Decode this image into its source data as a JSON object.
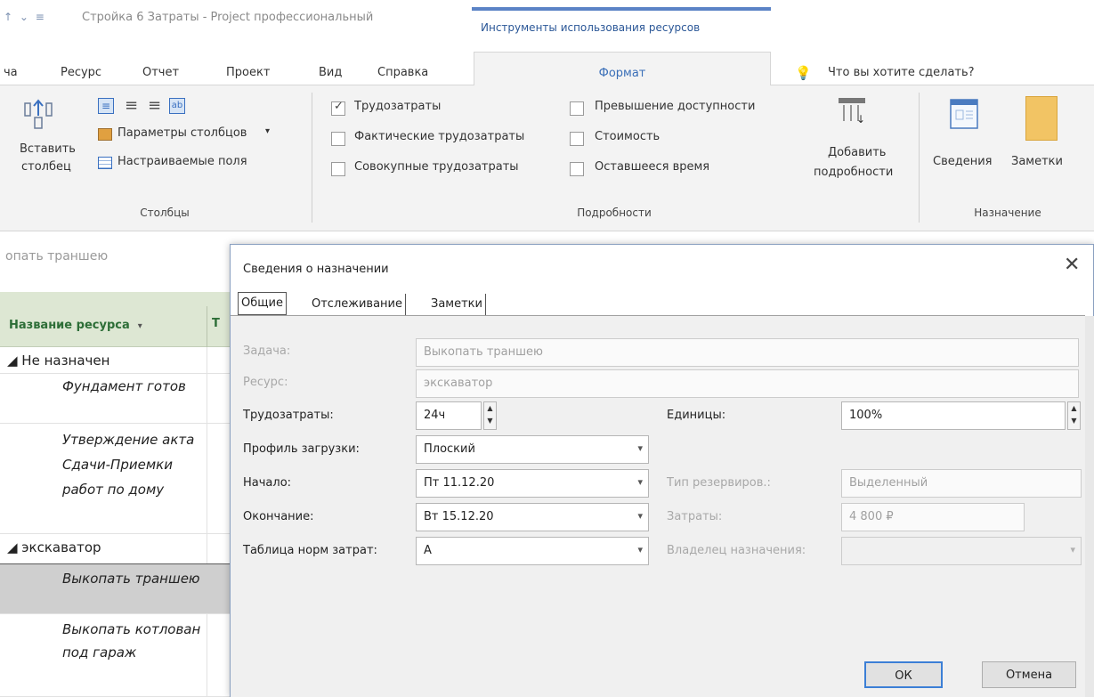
{
  "titlebar": {
    "qat": "↑ ⌄ ≡",
    "doc_title": "Стройка 6 Затраты - Project профессиональный",
    "context_tab": "Инструменты использования ресурсов"
  },
  "ribbon_tabs": {
    "task_partial": "ча",
    "resource": "Ресурс",
    "report": "Отчет",
    "project": "Проект",
    "view": "Вид",
    "help": "Справка",
    "format": "Формат",
    "tell_me": "Что вы хотите сделать?"
  },
  "ribbon": {
    "insert_column_line1": "Вставить",
    "insert_column_line2": "столбец",
    "column_settings": "Параметры столбцов",
    "custom_fields": "Настраиваемые поля",
    "columns_group": "Столбцы",
    "details": {
      "work": "Трудозатраты",
      "actual_work": "Фактические трудозатраты",
      "cumulative_work": "Совокупные трудозатраты",
      "overallocation": "Превышение доступности",
      "cost": "Стоимость",
      "remaining": "Оставшееся время",
      "add_details_line1": "Добавить",
      "add_details_line2": "подробности",
      "group": "Подробности"
    },
    "assignment": {
      "info": "Сведения",
      "notes": "Заметки",
      "group": "Назначение"
    }
  },
  "sheet": {
    "task_strip": "опать траншею",
    "col_name": "Название ресурса",
    "col_next": "Т",
    "rows": [
      {
        "label": "◢ Не назначен"
      },
      {
        "label": "Фундамент готов"
      },
      {
        "label": "Утверждение акта Сдачи-Приемки работ по дому"
      },
      {
        "label": "◢ экскаватор"
      },
      {
        "label": "Выкопать траншею"
      },
      {
        "label": "Выкопать котлован под гараж"
      }
    ]
  },
  "dialog": {
    "title": "Сведения о назначении",
    "tabs": [
      "Общие",
      "Отслеживание",
      "Заметки"
    ],
    "fields": {
      "task_label": "Задача:",
      "task_value": "Выкопать траншею",
      "resource_label": "Ресурс:",
      "resource_value": "экскаватор",
      "work_label": "Трудозатраты:",
      "work_value": "24ч",
      "units_label": "Единицы:",
      "units_value": "100%",
      "contour_label": "Профиль загрузки:",
      "contour_value": "Плоский",
      "start_label": "Начало:",
      "start_value": "Пт 11.12.20",
      "booking_label": "Тип резервиров.:",
      "booking_value": "Выделенный",
      "finish_label": "Окончание:",
      "finish_value": "Вт 15.12.20",
      "cost_label": "Затраты:",
      "cost_value": "4 800 ₽",
      "rate_label": "Таблица норм затрат:",
      "rate_value": "A",
      "owner_label": "Владелец назначения:",
      "owner_value": ""
    },
    "ok": "ОК",
    "cancel": "Отмена"
  },
  "colors": {
    "accent": "#2b5797",
    "sheet_header": "#dde7d3",
    "sheet_header_text": "#2d6e37",
    "ok_border": "#3c7fd6"
  }
}
